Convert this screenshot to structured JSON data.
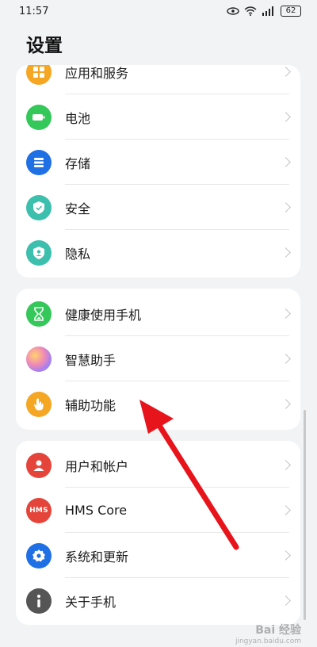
{
  "status_bar": {
    "time": "11:57",
    "battery": "62"
  },
  "page": {
    "title": "设置"
  },
  "groups": [
    {
      "items": [
        {
          "label": "应用和服务",
          "icon": "apps-icon",
          "color": "#f5a623"
        },
        {
          "label": "电池",
          "icon": "battery-icon",
          "color": "#34c759"
        },
        {
          "label": "存储",
          "icon": "storage-icon",
          "color": "#1f6fe5"
        },
        {
          "label": "安全",
          "icon": "shield-icon",
          "color": "#3dbfae"
        },
        {
          "label": "隐私",
          "icon": "privacy-icon",
          "color": "#3dbfae"
        }
      ]
    },
    {
      "items": [
        {
          "label": "健康使用手机",
          "icon": "hourglass-icon",
          "color": "#34c759"
        },
        {
          "label": "智慧助手",
          "icon": "assistant-icon",
          "color": "#d08be8"
        },
        {
          "label": "辅助功能",
          "icon": "hand-icon",
          "color": "#f5a623"
        }
      ]
    },
    {
      "items": [
        {
          "label": "用户和帐户",
          "icon": "user-icon",
          "color": "#e5443a"
        },
        {
          "label": "HMS Core",
          "icon": "hms-icon",
          "color": "#e5443a",
          "icon_text": "HMS"
        },
        {
          "label": "系统和更新",
          "icon": "gear-icon",
          "color": "#1f6fe5"
        },
        {
          "label": "关于手机",
          "icon": "info-icon",
          "color": "#555555"
        }
      ]
    }
  ],
  "watermark": {
    "text": "Bai 经验",
    "sub": "jingyan.baidu.com"
  }
}
